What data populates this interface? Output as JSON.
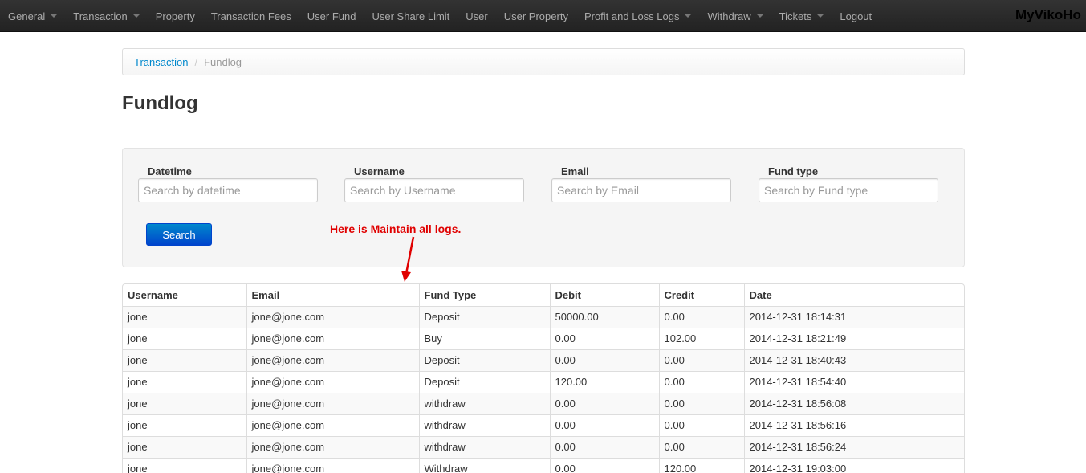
{
  "navbar": {
    "items": [
      {
        "label": "General",
        "dropdown": true
      },
      {
        "label": "Transaction",
        "dropdown": true
      },
      {
        "label": "Property",
        "dropdown": false
      },
      {
        "label": "Transaction Fees",
        "dropdown": false
      },
      {
        "label": "User Fund",
        "dropdown": false
      },
      {
        "label": "User Share Limit",
        "dropdown": false
      },
      {
        "label": "User",
        "dropdown": false
      },
      {
        "label": "User Property",
        "dropdown": false
      },
      {
        "label": "Profit and Loss Logs",
        "dropdown": true
      },
      {
        "label": "Withdraw",
        "dropdown": true
      },
      {
        "label": "Tickets",
        "dropdown": true
      },
      {
        "label": "Logout",
        "dropdown": false
      }
    ],
    "brand": "MyVikoHo"
  },
  "breadcrumb": {
    "parent": "Transaction",
    "separator": "/",
    "current": "Fundlog"
  },
  "page_title": "Fundlog",
  "search": {
    "fields": [
      {
        "label": "Datetime",
        "placeholder": "Search by datetime",
        "value": ""
      },
      {
        "label": "Username",
        "placeholder": "Search by Username",
        "value": ""
      },
      {
        "label": "Email",
        "placeholder": "Search by Email",
        "value": ""
      },
      {
        "label": "Fund type",
        "placeholder": "Search by Fund type",
        "value": ""
      }
    ],
    "button_label": "Search"
  },
  "annotation": "Here is Maintain all logs.",
  "table": {
    "columns": [
      "Username",
      "Email",
      "Fund Type",
      "Debit",
      "Credit",
      "Date"
    ],
    "rows": [
      [
        "jone",
        "jone@jone.com",
        "Deposit",
        "50000.00",
        "0.00",
        "2014-12-31 18:14:31"
      ],
      [
        "jone",
        "jone@jone.com",
        "Buy",
        "0.00",
        "102.00",
        "2014-12-31 18:21:49"
      ],
      [
        "jone",
        "jone@jone.com",
        "Deposit",
        "0.00",
        "0.00",
        "2014-12-31 18:40:43"
      ],
      [
        "jone",
        "jone@jone.com",
        "Deposit",
        "120.00",
        "0.00",
        "2014-12-31 18:54:40"
      ],
      [
        "jone",
        "jone@jone.com",
        "withdraw",
        "0.00",
        "0.00",
        "2014-12-31 18:56:08"
      ],
      [
        "jone",
        "jone@jone.com",
        "withdraw",
        "0.00",
        "0.00",
        "2014-12-31 18:56:16"
      ],
      [
        "jone",
        "jone@jone.com",
        "withdraw",
        "0.00",
        "0.00",
        "2014-12-31 18:56:24"
      ],
      [
        "jone",
        "jone@jone.com",
        "Withdraw",
        "0.00",
        "120.00",
        "2014-12-31 19:03:00"
      ]
    ]
  },
  "colors": {
    "navbar_bg": "#222222",
    "link": "#0088cc",
    "button": "#0055cc",
    "annotation": "#e00000"
  }
}
